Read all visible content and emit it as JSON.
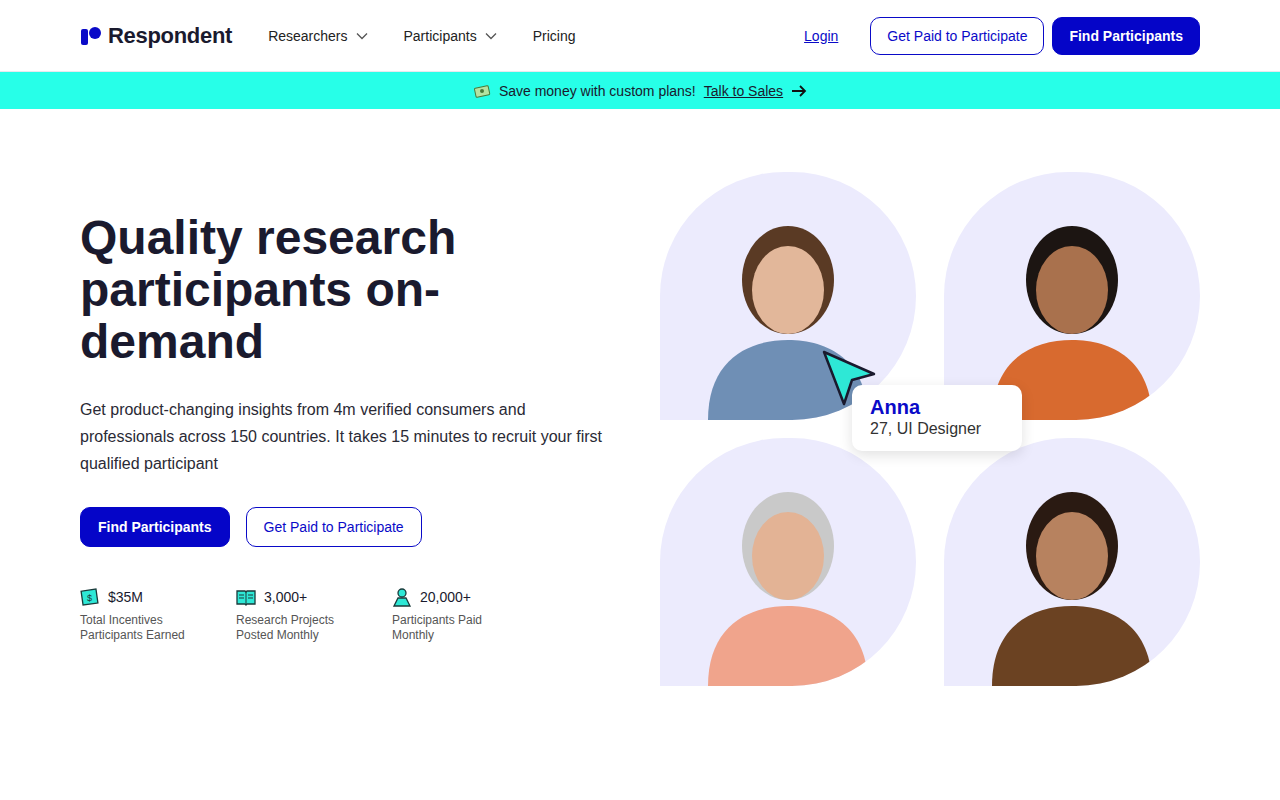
{
  "nav": {
    "logo": "Respondent",
    "items": [
      {
        "label": "Researchers",
        "dropdown": true
      },
      {
        "label": "Participants",
        "dropdown": true
      },
      {
        "label": "Pricing",
        "dropdown": false
      }
    ],
    "login": "Login",
    "buttons": [
      {
        "label": "Get Paid to Participate",
        "kind": "outline"
      },
      {
        "label": "Find Participants",
        "kind": "primary"
      }
    ]
  },
  "banner": {
    "text": "Save money with custom plans!",
    "link": "Talk to Sales"
  },
  "hero": {
    "title": "Quality research participants on-demand",
    "subtitle": "Get product-changing insights from 4m verified consumers and professionals across 150 countries. It takes 15 minutes to recruit your first qualified participant",
    "buttons": [
      {
        "label": "Find Participants",
        "kind": "primary"
      },
      {
        "label": "Get Paid to Participate",
        "kind": "outline"
      }
    ],
    "stats": [
      {
        "value": "$35M",
        "label": "Total Incentives Participants Earned",
        "kind": "money"
      },
      {
        "value": "3,000+",
        "label": "Research Projects Posted Monthly",
        "kind": "book"
      },
      {
        "value": "20,000+",
        "label": "Participants Paid Monthly",
        "kind": "person"
      }
    ]
  },
  "profile_card": {
    "name": "Anna",
    "detail": "27, UI Designer"
  }
}
